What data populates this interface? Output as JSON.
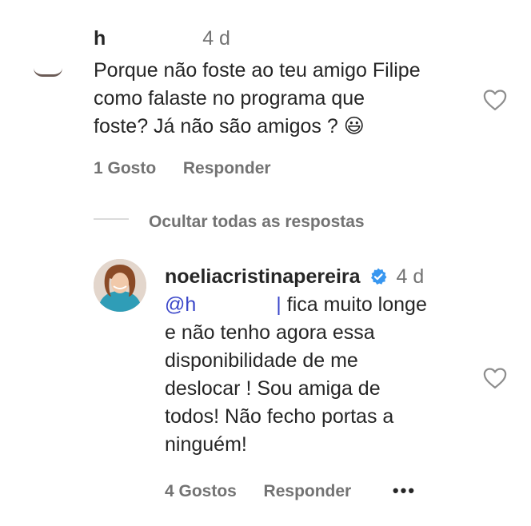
{
  "comment": {
    "username": "h",
    "time": "4 d",
    "lines": [
      "Porque não foste ao teu amigo Filipe",
      "como falaste no programa que",
      "foste? Já não são amigos ? 😃"
    ],
    "likes": "1 Gosto",
    "reply_label": "Responder"
  },
  "replies_toggle": {
    "label": "Ocultar todas as respostas"
  },
  "reply": {
    "username": "noeliacristinapereira",
    "time": "4 d",
    "mention": "@h",
    "line1_rest": "fica muito longe",
    "lines": [
      "e não tenho agora essa",
      "disponibilidade de me",
      "deslocar ! Sou amiga de",
      "todos! Não fecho portas a",
      "ninguém!"
    ],
    "likes": "4 Gostos",
    "reply_label": "Responder",
    "more_label": "•••"
  },
  "colors": {
    "verified": "#3897f0",
    "mention": "#3a46c9",
    "muted": "#737373"
  }
}
